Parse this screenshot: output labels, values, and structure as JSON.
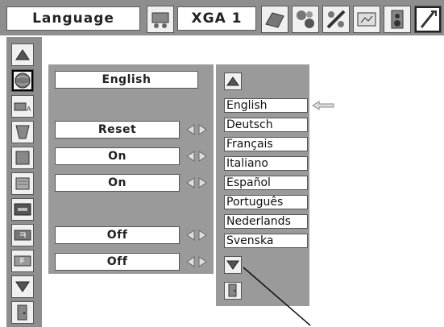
{
  "topbar": {
    "menu_title": "Language",
    "input_source": "XGA 1",
    "icons": [
      "pc-adjust-icon",
      "image-select-icon",
      "image-adjust-icon",
      "screen-icon",
      "sound-icon",
      "setting-icon",
      "expand-icon"
    ]
  },
  "sidebar": {
    "icons": [
      "up-arrow-icon",
      "language-globe-icon",
      "auto-setup-icon",
      "keystone-icon",
      "background-icon",
      "display-icon",
      "logo-icon",
      "ceiling-icon",
      "rear-icon",
      "down-arrow-icon",
      "exit-icon"
    ]
  },
  "main": {
    "rows": [
      {
        "value": "English",
        "arrows": false
      },
      {
        "value": "Reset",
        "arrows": true
      },
      {
        "value": "On",
        "arrows": true
      },
      {
        "value": "On",
        "arrows": true
      },
      {
        "value": "Off",
        "arrows": true
      },
      {
        "value": "Off",
        "arrows": true
      }
    ]
  },
  "language_panel": {
    "options": [
      "English",
      "Deutsch",
      "Français",
      "Italiano",
      "Español",
      "Português",
      "Nederlands",
      "Svenska"
    ],
    "selected": "English"
  },
  "colors": {
    "panel_gray": "#8e8e8e",
    "box_white": "#ffffff",
    "text_dark": "#222222"
  }
}
